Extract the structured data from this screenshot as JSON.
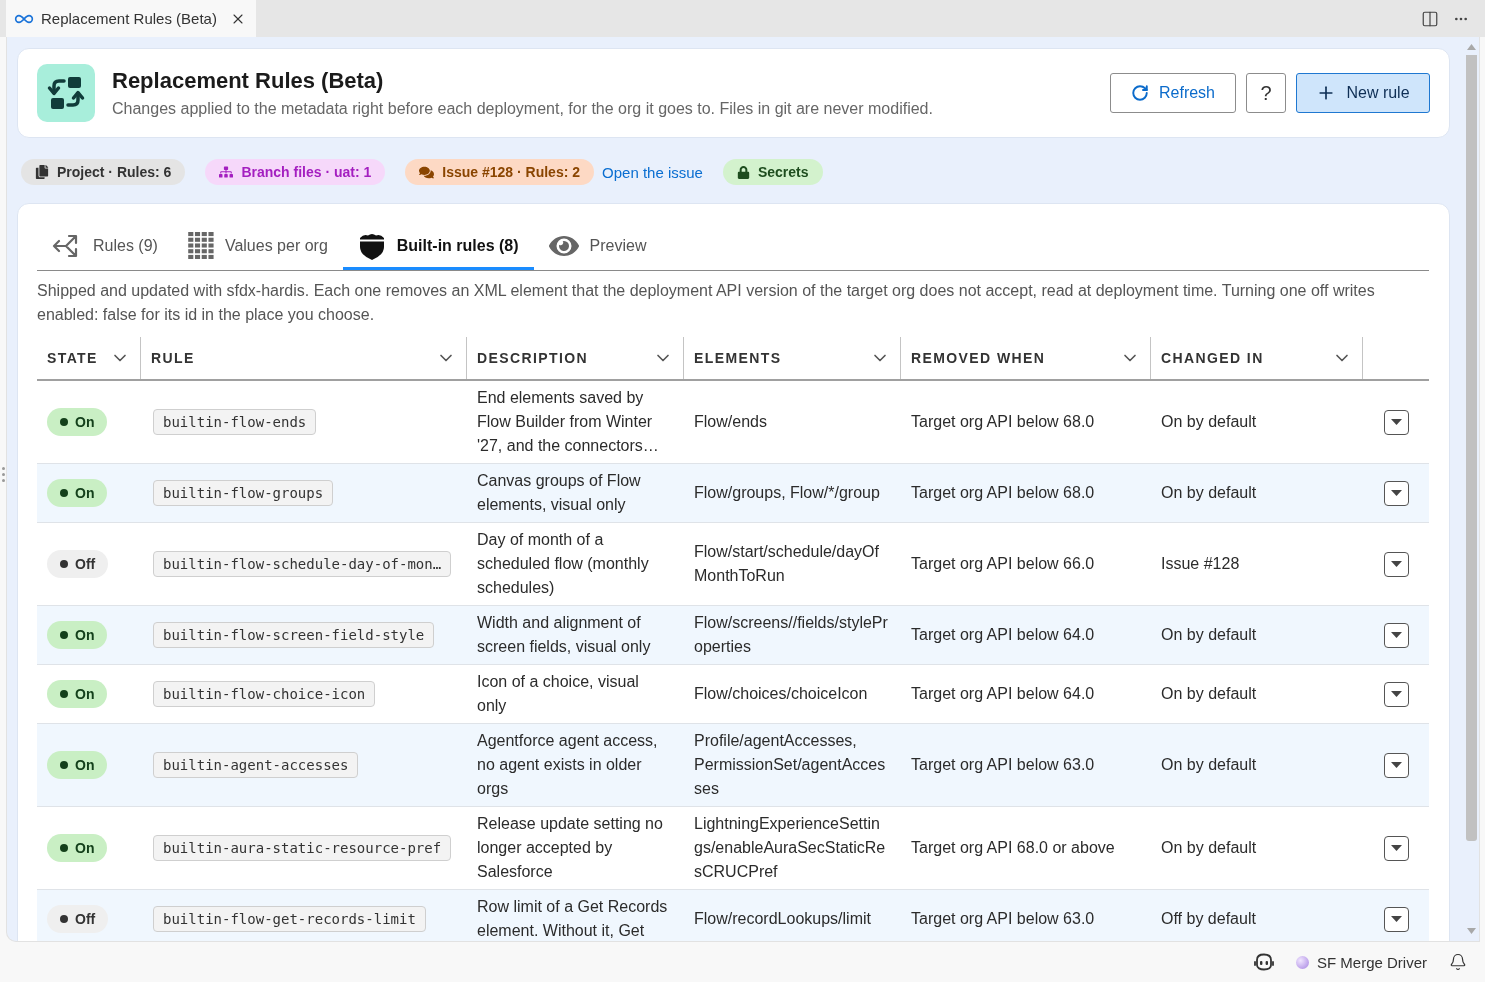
{
  "editor_tab": {
    "title": "Replacement Rules (Beta)"
  },
  "header": {
    "title": "Replacement Rules (Beta)",
    "subtitle": "Changes applied to the metadata right before each deployment, for the org it goes to. Files in git are never modified.",
    "buttons": [
      {
        "kind": "refresh",
        "label": "Refresh"
      },
      {
        "kind": "help",
        "label": "?"
      },
      {
        "kind": "primary",
        "label": "New rule"
      }
    ]
  },
  "badges": [
    {
      "kind": "project",
      "label": "Project · Rules: 6"
    },
    {
      "kind": "branch",
      "label": "Branch files · uat: 1"
    },
    {
      "kind": "issue",
      "label": "Issue #128 · Rules: 2"
    },
    {
      "kind": "link",
      "label": "Open the issue"
    },
    {
      "kind": "secrets",
      "label": "Secrets"
    }
  ],
  "tabs": [
    {
      "kind": "rules",
      "label": "Rules (9)",
      "selected": false
    },
    {
      "kind": "values",
      "label": "Values per org",
      "selected": false
    },
    {
      "kind": "builtin",
      "label": "Built-in rules (8)",
      "selected": true
    },
    {
      "kind": "preview",
      "label": "Preview",
      "selected": false
    }
  ],
  "intro": "Shipped and updated with sfdx-hardis. Each one removes an XML element that the deployment API version of the target org does not accept, read at deployment time. Turning one off writes enabled: false for its id in the place you choose.",
  "table": {
    "columns": [
      "STATE",
      "RULE",
      "DESCRIPTION",
      "ELEMENTS",
      "REMOVED WHEN",
      "CHANGED IN"
    ],
    "rows": [
      {
        "state": "On",
        "on": true,
        "rule": "builtin-flow-ends",
        "description": "End elements saved by Flow Builder from Winter '27, and the connectors…",
        "elements": "Flow/ends",
        "removed_when": "Target org API below 68.0",
        "changed_in": "On by default"
      },
      {
        "state": "On",
        "on": true,
        "rule": "builtin-flow-groups",
        "description": "Canvas groups of Flow elements, visual only",
        "elements": "Flow/groups, Flow/*/group",
        "removed_when": "Target org API below 68.0",
        "changed_in": "On by default"
      },
      {
        "state": "Off",
        "on": false,
        "rule": "builtin-flow-schedule-day-of-mon…",
        "description": "Day of month of a scheduled flow (monthly schedules)",
        "elements": "Flow/start/schedule/dayOfMonthToRun",
        "removed_when": "Target org API below 66.0",
        "changed_in": "Issue #128"
      },
      {
        "state": "On",
        "on": true,
        "rule": "builtin-flow-screen-field-style",
        "description": "Width and alignment of screen fields, visual only",
        "elements": "Flow/screens//fields/styleProperties",
        "removed_when": "Target org API below 64.0",
        "changed_in": "On by default"
      },
      {
        "state": "On",
        "on": true,
        "rule": "builtin-flow-choice-icon",
        "description": "Icon of a choice, visual only",
        "elements": "Flow/choices/choiceIcon",
        "removed_when": "Target org API below 64.0",
        "changed_in": "On by default"
      },
      {
        "state": "On",
        "on": true,
        "rule": "builtin-agent-accesses",
        "description": "Agentforce agent access, no agent exists in older orgs",
        "elements": "Profile/agentAccesses, PermissionSet/agentAccesses",
        "removed_when": "Target org API below 63.0",
        "changed_in": "On by default"
      },
      {
        "state": "On",
        "on": true,
        "rule": "builtin-aura-static-resource-pref",
        "description": "Release update setting no longer accepted by Salesforce",
        "elements": "LightningExperienceSettings/enableAuraSecStaticResCRUCPref",
        "removed_when": "Target org API 68.0 or above",
        "changed_in": "On by default"
      },
      {
        "state": "Off",
        "on": false,
        "rule": "builtin-flow-get-records-limit",
        "description": "Row limit of a Get Records element. Without it, Get",
        "elements": "Flow/recordLookups/limit",
        "removed_when": "Target org API below 63.0",
        "changed_in": "Off by default"
      }
    ]
  },
  "status_bar": {
    "extension": "SF Merge Driver"
  }
}
